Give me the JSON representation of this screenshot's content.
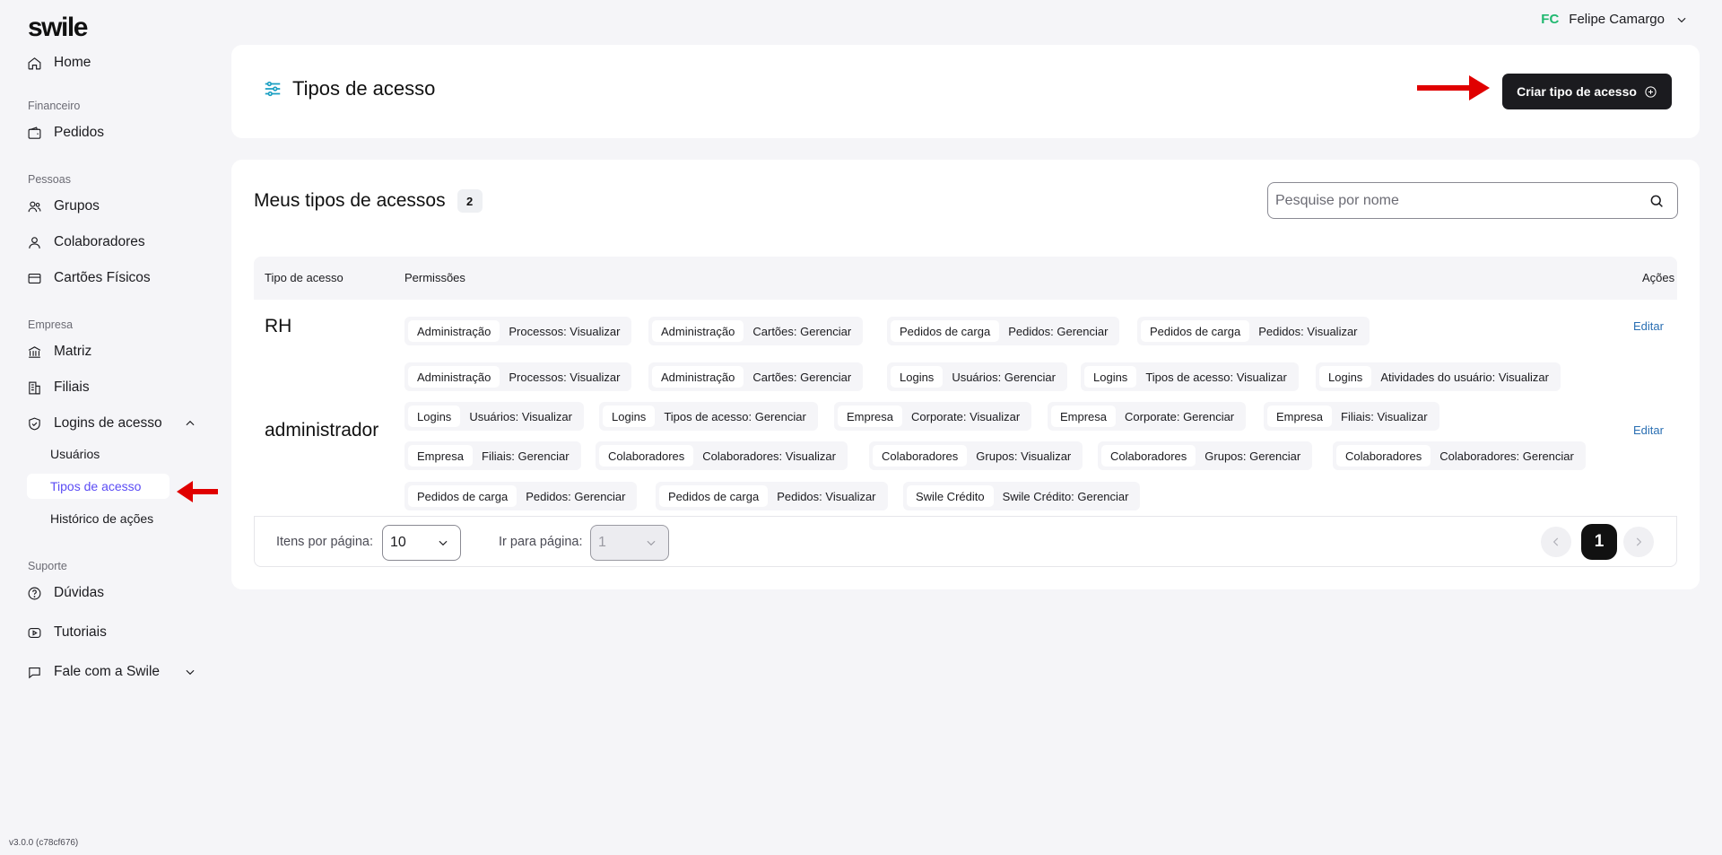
{
  "app": {
    "logo": "swile",
    "version": "v3.0.0 (c78cf676)"
  },
  "user": {
    "initials": "FC",
    "name": "Felipe Camargo"
  },
  "sidebar": {
    "home": "Home",
    "section_financeiro": "Financeiro",
    "pedidos": "Pedidos",
    "section_pessoas": "Pessoas",
    "grupos": "Grupos",
    "colaboradores": "Colaboradores",
    "cartoes": "Cartões Físicos",
    "section_empresa": "Empresa",
    "matriz": "Matriz",
    "filiais": "Filiais",
    "logins": "Logins de acesso",
    "usuarios": "Usuários",
    "tipos": "Tipos de acesso",
    "historico": "Histórico de ações",
    "section_suporte": "Suporte",
    "duvidas": "Dúvidas",
    "tutoriais": "Tutoriais",
    "fale": "Fale com a Swile"
  },
  "header": {
    "title": "Tipos de acesso",
    "create_button": "Criar tipo de acesso"
  },
  "main": {
    "title": "Meus tipos de acessos",
    "count": "2",
    "search_placeholder": "Pesquise por nome",
    "columns": {
      "tipo": "Tipo de acesso",
      "permissoes": "Permissões",
      "acoes": "Ações"
    },
    "rows": [
      {
        "name": "RH",
        "edit": "Editar",
        "permissions": [
          [
            "Administração",
            "Processos: Visualizar"
          ],
          [
            "Administração",
            "Cartões: Gerenciar"
          ],
          [
            "Pedidos de carga",
            "Pedidos: Gerenciar"
          ],
          [
            "Pedidos de carga",
            "Pedidos: Visualizar"
          ]
        ]
      },
      {
        "name": "administrador",
        "edit": "Editar",
        "permissions": [
          [
            "Administração",
            "Processos: Visualizar"
          ],
          [
            "Administração",
            "Cartões: Gerenciar"
          ],
          [
            "Logins",
            "Usuários: Gerenciar"
          ],
          [
            "Logins",
            "Tipos de acesso: Visualizar"
          ],
          [
            "Logins",
            "Atividades do usuário: Visualizar"
          ],
          [
            "Logins",
            "Usuários: Visualizar"
          ],
          [
            "Logins",
            "Tipos de acesso: Gerenciar"
          ],
          [
            "Empresa",
            "Corporate: Visualizar"
          ],
          [
            "Empresa",
            "Corporate: Gerenciar"
          ],
          [
            "Empresa",
            "Filiais: Visualizar"
          ],
          [
            "Empresa",
            "Filiais: Gerenciar"
          ],
          [
            "Colaboradores",
            "Colaboradores: Visualizar"
          ],
          [
            "Colaboradores",
            "Grupos: Visualizar"
          ],
          [
            "Colaboradores",
            "Grupos: Gerenciar"
          ],
          [
            "Colaboradores",
            "Colaboradores: Gerenciar"
          ],
          [
            "Pedidos de carga",
            "Pedidos: Gerenciar"
          ],
          [
            "Pedidos de carga",
            "Pedidos: Visualizar"
          ],
          [
            "Swile Crédito",
            "Swile Crédito: Gerenciar"
          ]
        ]
      }
    ],
    "pagination": {
      "items_label": "Itens por página:",
      "items_value": "10",
      "goto_label": "Ir para página:",
      "goto_value": "1",
      "current_page": "1"
    }
  },
  "colors": {
    "accent": "#5b4cf5",
    "brand_dark": "#1b1b1f",
    "annotation_arrow": "#e00000",
    "initials": "#1fb86f",
    "link": "#2a6fb3"
  }
}
